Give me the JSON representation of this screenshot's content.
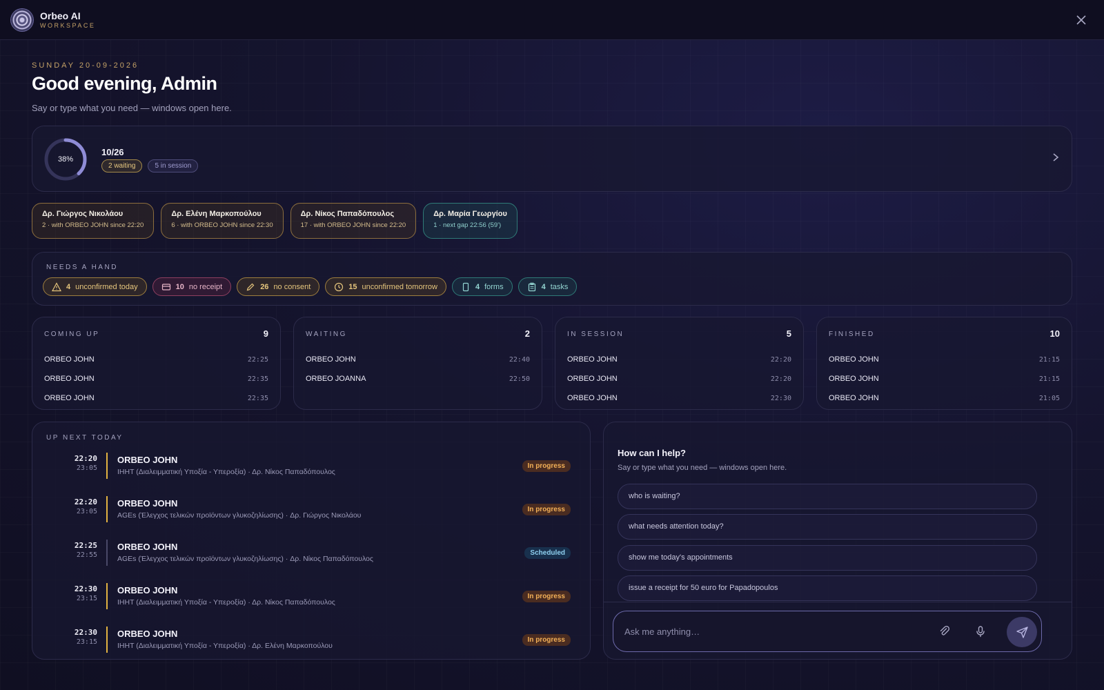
{
  "app": {
    "name": "Orbeo AI",
    "subtitle": "WORKSPACE"
  },
  "header": {
    "date": "SUNDAY 20-09-2026",
    "greeting": "Good evening, Admin",
    "subtitle": "Say or type what you need — windows open here."
  },
  "progress": {
    "percent_label": "38%",
    "percent": 38,
    "count": "10/26",
    "waiting_chip": "2 waiting",
    "session_chip": "5 in session",
    "ring_color": "#8f8cd6"
  },
  "doctors": [
    {
      "name": "Δρ. Γιώργος Νικολάου",
      "meta": "2 · with ORBEO JOHN since 22:20",
      "tone": "amber"
    },
    {
      "name": "Δρ. Ελένη Μαρκοπούλου",
      "meta": "6 · with ORBEO JOHN since 22:30",
      "tone": "amber"
    },
    {
      "name": "Δρ. Νίκος Παπαδόπουλος",
      "meta": "17 · with ORBEO JOHN since 22:20",
      "tone": "amber"
    },
    {
      "name": "Δρ. Μαρία Γεωργίου",
      "meta": "1 · next gap 22:56 (59')",
      "tone": "teal"
    }
  ],
  "needs": {
    "label": "NEEDS A HAND",
    "items": [
      {
        "count": "4",
        "label": "unconfirmed today",
        "icon": "warning-icon",
        "tone": "amber"
      },
      {
        "count": "10",
        "label": "no receipt",
        "icon": "card-icon",
        "tone": "rose"
      },
      {
        "count": "26",
        "label": "no consent",
        "icon": "pencil-icon",
        "tone": "amber"
      },
      {
        "count": "15",
        "label": "unconfirmed tomorrow",
        "icon": "clock-icon",
        "tone": "amber"
      },
      {
        "count": "4",
        "label": "forms",
        "icon": "tablet-icon",
        "tone": "teal"
      },
      {
        "count": "4",
        "label": "tasks",
        "icon": "clipboard-icon",
        "tone": "teal"
      }
    ]
  },
  "columns": [
    {
      "title": "COMING UP",
      "count": "9",
      "rows": [
        {
          "name": "ORBEO JOHN",
          "time": "22:25"
        },
        {
          "name": "ORBEO JOHN",
          "time": "22:35"
        },
        {
          "name": "ORBEO JOHN",
          "time": "22:35"
        }
      ]
    },
    {
      "title": "WAITING",
      "count": "2",
      "rows": [
        {
          "name": "ORBEO JOHN",
          "time": "22:40"
        },
        {
          "name": "ORBEO JOANNA",
          "time": "22:50"
        }
      ]
    },
    {
      "title": "IN SESSION",
      "count": "5",
      "rows": [
        {
          "name": "ORBEO JOHN",
          "time": "22:20"
        },
        {
          "name": "ORBEO JOHN",
          "time": "22:20"
        },
        {
          "name": "ORBEO JOHN",
          "time": "22:30"
        }
      ]
    },
    {
      "title": "FINISHED",
      "count": "10",
      "rows": [
        {
          "name": "ORBEO JOHN",
          "time": "21:15"
        },
        {
          "name": "ORBEO JOHN",
          "time": "21:15"
        },
        {
          "name": "ORBEO JOHN",
          "time": "21:05"
        }
      ]
    }
  ],
  "up_next": {
    "label": "UP NEXT TODAY",
    "items": [
      {
        "start": "22:20",
        "end": "23:05",
        "patient": "ORBEO JOHN",
        "desc": "ΙΗΗΤ (Διαλειμματική Υποξία - Υπεροξία) · Δρ. Νίκος Παπαδόπουλος",
        "status": "In progress",
        "kind": "progress"
      },
      {
        "start": "22:20",
        "end": "23:05",
        "patient": "ORBEO JOHN",
        "desc": "AGEs (Έλεγχος τελικών προϊόντων γλυκοζηλίωσης) · Δρ. Γιώργος Νικολάου",
        "status": "In progress",
        "kind": "progress"
      },
      {
        "start": "22:25",
        "end": "22:55",
        "patient": "ORBEO JOHN",
        "desc": "AGEs (Έλεγχος τελικών προϊόντων γλυκοζηλίωσης) · Δρ. Νίκος Παπαδόπουλος",
        "status": "Scheduled",
        "kind": "scheduled"
      },
      {
        "start": "22:30",
        "end": "23:15",
        "patient": "ORBEO JOHN",
        "desc": "ΙΗΗΤ (Διαλειμματική Υποξία - Υπεροξία) · Δρ. Νίκος Παπαδόπουλος",
        "status": "In progress",
        "kind": "progress"
      },
      {
        "start": "22:30",
        "end": "23:15",
        "patient": "ORBEO JOHN",
        "desc": "ΙΗΗΤ (Διαλειμματική Υποξία - Υπεροξία) · Δρ. Ελένη Μαρκοπούλου",
        "status": "In progress",
        "kind": "progress"
      }
    ]
  },
  "assistant": {
    "title": "How can I help?",
    "subtitle": "Say or type what you need — windows open here.",
    "suggestions": [
      "who is waiting?",
      "what needs attention today?",
      "show me today's appointments",
      "issue a receipt for 50 euro for Papadopoulos"
    ],
    "placeholder": "Ask me anything…"
  }
}
